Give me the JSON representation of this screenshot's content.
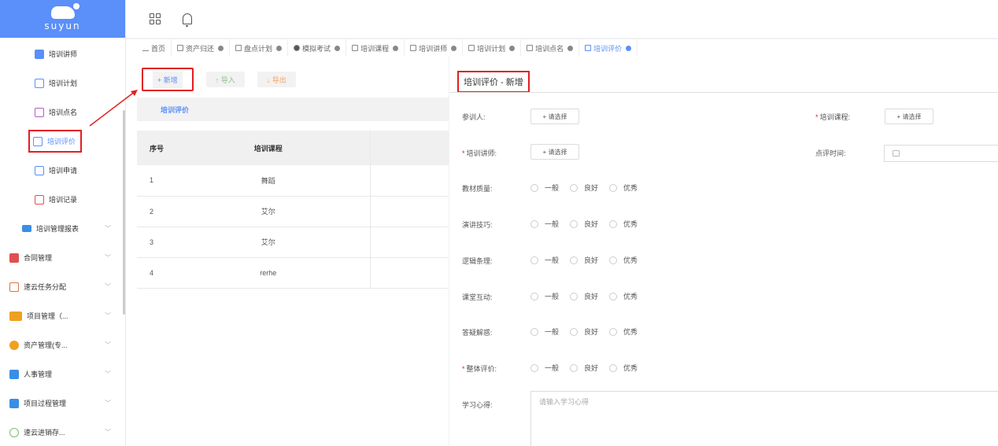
{
  "logo": {
    "brand": "suyun"
  },
  "sidebar": {
    "items": [
      {
        "label": "培训讲师",
        "icon": "teacher-icon",
        "kind": "sub"
      },
      {
        "label": "培训计划",
        "icon": "plan-icon",
        "kind": "sub"
      },
      {
        "label": "培训点名",
        "icon": "rollcall-icon",
        "kind": "sub"
      },
      {
        "label": "培训评价",
        "icon": "evaluation-icon",
        "kind": "sub",
        "active": true
      },
      {
        "label": "培训申请",
        "icon": "apply-icon",
        "kind": "sub"
      },
      {
        "label": "培训记录",
        "icon": "record-icon",
        "kind": "sub"
      },
      {
        "label": "培训管理报表",
        "icon": "folder-icon",
        "kind": "group"
      },
      {
        "label": "合同管理",
        "icon": "contract-icon",
        "kind": "top"
      },
      {
        "label": "速云任务分配",
        "icon": "task-icon",
        "kind": "top"
      },
      {
        "label": "项目管理（...",
        "icon": "project-icon",
        "kind": "top"
      },
      {
        "label": "资产管理(专...",
        "icon": "asset-icon",
        "kind": "top"
      },
      {
        "label": "人事管理",
        "icon": "hr-icon",
        "kind": "top"
      },
      {
        "label": "项目过程管理",
        "icon": "process-icon",
        "kind": "top"
      },
      {
        "label": "速云进销存...",
        "icon": "inventory-icon",
        "kind": "top"
      }
    ]
  },
  "tabs": [
    {
      "label": "首页",
      "closable": false
    },
    {
      "label": "资产归还",
      "closable": true
    },
    {
      "label": "盘点计划",
      "closable": true
    },
    {
      "label": "模拟考试",
      "closable": true
    },
    {
      "label": "培训课程",
      "closable": true
    },
    {
      "label": "培训讲师",
      "closable": true
    },
    {
      "label": "培训计划",
      "closable": true
    },
    {
      "label": "培训点名",
      "closable": true
    },
    {
      "label": "培训评价",
      "closable": true,
      "active": true
    }
  ],
  "toolbar": {
    "add": "+ 新增",
    "import": "↑ 导入",
    "export": "↓ 导出"
  },
  "list": {
    "section_title": "培训评价",
    "columns": [
      "序号",
      "培训课程"
    ],
    "rows": [
      {
        "no": "1",
        "course": "舞蹈"
      },
      {
        "no": "2",
        "course": "艾尔"
      },
      {
        "no": "3",
        "course": "艾尔"
      },
      {
        "no": "4",
        "course": "rerhe"
      }
    ]
  },
  "form": {
    "title": "培训评价 - 新增",
    "participant_label": "参训人:",
    "course_label": "培训课程:",
    "lecturer_label": "培训讲师:",
    "review_time_label": "点评时间:",
    "select_text": "+ 请选择",
    "ratings": [
      {
        "label": "教材质量:",
        "required": false
      },
      {
        "label": "演讲技巧:",
        "required": false
      },
      {
        "label": "逻辑条理:",
        "required": false
      },
      {
        "label": "课堂互动:",
        "required": false
      },
      {
        "label": "答疑解惑:",
        "required": false
      },
      {
        "label": "整体评价:",
        "required": true
      }
    ],
    "options": [
      "一般",
      "良好",
      "优秀"
    ],
    "notes_label": "学习心得:",
    "notes_placeholder": "请输入学习心得"
  },
  "colors": {
    "accent": "#5b8ff9",
    "highlight": "#e02020"
  }
}
